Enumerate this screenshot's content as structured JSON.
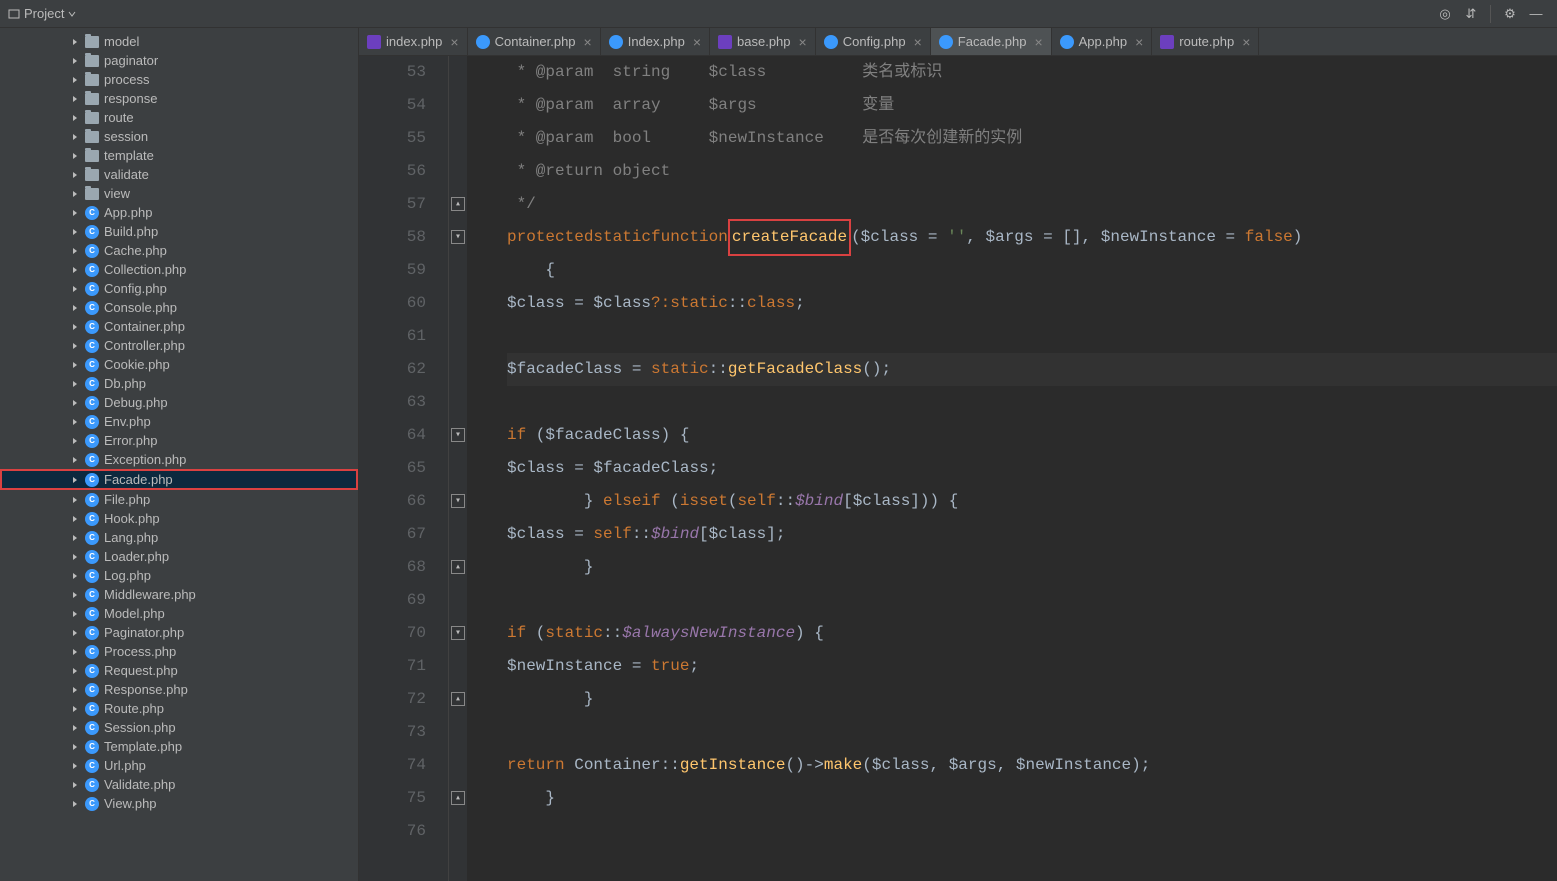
{
  "toolbar": {
    "project_label": "Project"
  },
  "tabs": [
    {
      "label": "index.php",
      "iconType": "file",
      "active": false
    },
    {
      "label": "Container.php",
      "iconType": "class",
      "active": false
    },
    {
      "label": "Index.php",
      "iconType": "class",
      "active": false
    },
    {
      "label": "base.php",
      "iconType": "file",
      "active": false
    },
    {
      "label": "Config.php",
      "iconType": "class",
      "active": false
    },
    {
      "label": "Facade.php",
      "iconType": "class",
      "active": true
    },
    {
      "label": "App.php",
      "iconType": "class",
      "active": false
    },
    {
      "label": "route.php",
      "iconType": "file",
      "active": false
    }
  ],
  "tree": [
    {
      "label": "model",
      "type": "folder"
    },
    {
      "label": "paginator",
      "type": "folder"
    },
    {
      "label": "process",
      "type": "folder"
    },
    {
      "label": "response",
      "type": "folder"
    },
    {
      "label": "route",
      "type": "folder"
    },
    {
      "label": "session",
      "type": "folder"
    },
    {
      "label": "template",
      "type": "folder"
    },
    {
      "label": "validate",
      "type": "folder"
    },
    {
      "label": "view",
      "type": "folder"
    },
    {
      "label": "App.php",
      "type": "php"
    },
    {
      "label": "Build.php",
      "type": "php"
    },
    {
      "label": "Cache.php",
      "type": "php"
    },
    {
      "label": "Collection.php",
      "type": "php"
    },
    {
      "label": "Config.php",
      "type": "php"
    },
    {
      "label": "Console.php",
      "type": "php"
    },
    {
      "label": "Container.php",
      "type": "php"
    },
    {
      "label": "Controller.php",
      "type": "php"
    },
    {
      "label": "Cookie.php",
      "type": "php"
    },
    {
      "label": "Db.php",
      "type": "php"
    },
    {
      "label": "Debug.php",
      "type": "php"
    },
    {
      "label": "Env.php",
      "type": "php"
    },
    {
      "label": "Error.php",
      "type": "php"
    },
    {
      "label": "Exception.php",
      "type": "php"
    },
    {
      "label": "Facade.php",
      "type": "php",
      "selected": true
    },
    {
      "label": "File.php",
      "type": "php"
    },
    {
      "label": "Hook.php",
      "type": "php"
    },
    {
      "label": "Lang.php",
      "type": "php"
    },
    {
      "label": "Loader.php",
      "type": "php"
    },
    {
      "label": "Log.php",
      "type": "php"
    },
    {
      "label": "Middleware.php",
      "type": "php"
    },
    {
      "label": "Model.php",
      "type": "php"
    },
    {
      "label": "Paginator.php",
      "type": "php"
    },
    {
      "label": "Process.php",
      "type": "php"
    },
    {
      "label": "Request.php",
      "type": "php"
    },
    {
      "label": "Response.php",
      "type": "php"
    },
    {
      "label": "Route.php",
      "type": "php"
    },
    {
      "label": "Session.php",
      "type": "php"
    },
    {
      "label": "Template.php",
      "type": "php"
    },
    {
      "label": "Url.php",
      "type": "php"
    },
    {
      "label": "Validate.php",
      "type": "php"
    },
    {
      "label": "View.php",
      "type": "php"
    }
  ],
  "code": {
    "startLine": 53,
    "lines": [
      {
        "num": 53,
        "html": "    <span class='comment'> * @param  string    $class          类名或标识</span>"
      },
      {
        "num": 54,
        "html": "    <span class='comment'> * @param  array     $args           变量</span>"
      },
      {
        "num": 55,
        "html": "    <span class='comment'> * @param  bool      $newInstance    是否每次创建新的实例</span>"
      },
      {
        "num": 56,
        "html": "    <span class='comment'> * @return object</span>"
      },
      {
        "num": 57,
        "html": "    <span class='comment'> */</span>",
        "fold": "close"
      },
      {
        "num": 58,
        "html": "    <span class='kw'>protected</span> <span class='kw'>static</span> <span class='kw'>function</span> <span class='fn redbox'>createFacade</span>(<span class='var'>$class</span> = <span class='str'>''</span>, <span class='var'>$args</span> = [], <span class='var'>$newInstance</span> = <span class='kw'>false</span>)",
        "fold": "open"
      },
      {
        "num": 59,
        "html": "    {"
      },
      {
        "num": 60,
        "html": "        <span class='var'>$class</span> = <span class='var'>$class</span> <span class='kw'>?:</span> <span class='kw'>static</span>::<span class='kw'>class</span>;"
      },
      {
        "num": 61,
        "html": ""
      },
      {
        "num": 62,
        "html": "        <span class='var'>$facadeClass</span> = <span class='kw'>static</span>::<span class='call'>getFacadeClass</span>();",
        "highlight": true
      },
      {
        "num": 63,
        "html": ""
      },
      {
        "num": 64,
        "html": "        <span class='kw'>if</span> (<span class='var'>$facadeClass</span>) {",
        "fold": "open"
      },
      {
        "num": 65,
        "html": "            <span class='var'>$class</span> = <span class='var'>$facadeClass</span>;"
      },
      {
        "num": 66,
        "html": "        } <span class='kw'>elseif</span> (<span class='kw'>isset</span>(<span class='kw'>self</span>::<span class='ital'>$bind</span>[<span class='var'>$class</span>])) {",
        "fold": "open"
      },
      {
        "num": 67,
        "html": "            <span class='var'>$class</span> = <span class='kw'>self</span>::<span class='ital'>$bind</span>[<span class='var'>$class</span>];"
      },
      {
        "num": 68,
        "html": "        }",
        "fold": "close"
      },
      {
        "num": 69,
        "html": ""
      },
      {
        "num": 70,
        "html": "        <span class='kw'>if</span> (<span class='kw'>static</span>::<span class='ital'>$alwaysNewInstance</span>) {",
        "fold": "open"
      },
      {
        "num": 71,
        "html": "            <span class='var'>$newInstance</span> = <span class='kw'>true</span>;"
      },
      {
        "num": 72,
        "html": "        }",
        "fold": "close"
      },
      {
        "num": 73,
        "html": ""
      },
      {
        "num": 74,
        "html": "        <span class='kw'>return</span> Container::<span class='call'>getInstance</span>()-><span class='call'>make</span>(<span class='var'>$class</span>, <span class='var'>$args</span>, <span class='var'>$newInstance</span>);"
      },
      {
        "num": 75,
        "html": "    }",
        "fold": "close"
      },
      {
        "num": 76,
        "html": ""
      }
    ]
  }
}
